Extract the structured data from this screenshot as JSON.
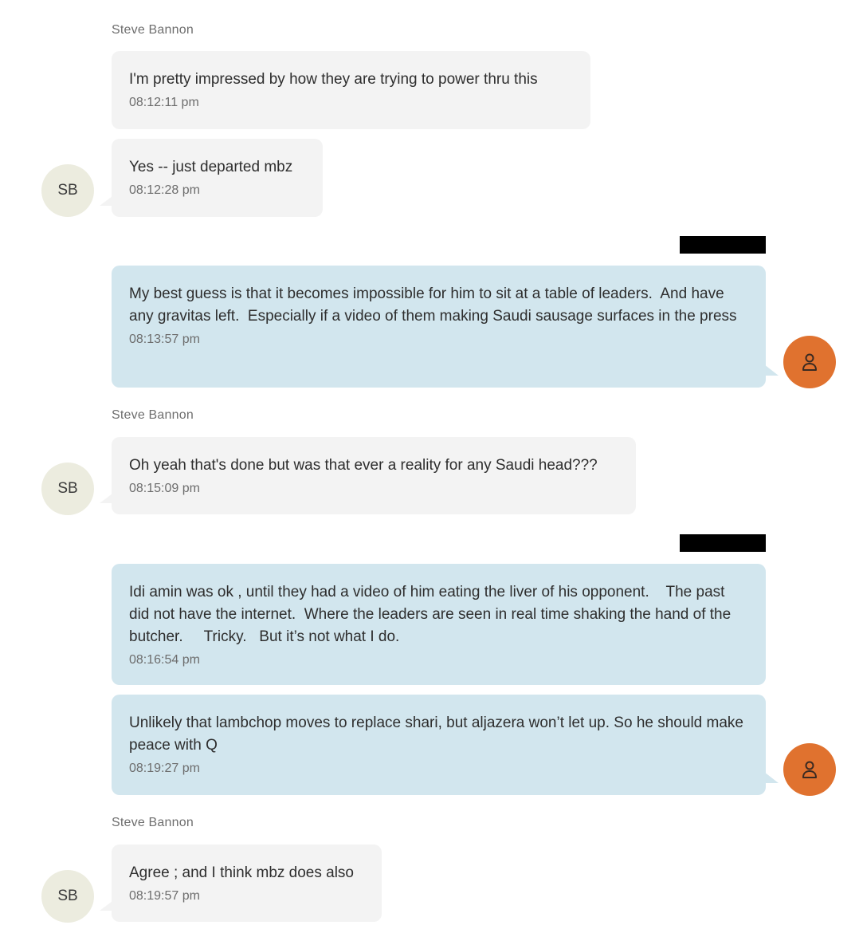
{
  "contact": {
    "name": "Steve Bannon",
    "initials": "SB"
  },
  "colors": {
    "incoming_bubble": "#f3f3f3",
    "outgoing_bubble": "#d2e6ee",
    "contact_avatar": "#ececdf",
    "user_avatar": "#e0722f",
    "redaction": "#000000"
  },
  "messages": [
    {
      "direction": "incoming",
      "text": "I'm pretty impressed by how they are trying to power thru this",
      "time": "08:12:11 pm"
    },
    {
      "direction": "incoming",
      "text": "Yes -- just departed mbz",
      "time": "08:12:28 pm"
    },
    {
      "direction": "outgoing",
      "text": "My best guess is that it becomes impossible for him to sit at a table of leaders.  And have any gravitas left.  Especially if a video of them making Saudi sausage surfaces in the press",
      "time": "08:13:57 pm"
    },
    {
      "direction": "incoming",
      "text": "Oh yeah that's done but was that ever a reality for any Saudi head???",
      "time": "08:15:09 pm"
    },
    {
      "direction": "outgoing",
      "text": "Idi amin was ok , until they had a video of him eating the liver of his opponent.    The past did not have the internet.  Where the leaders are seen in real time shaking the hand of the butcher.     Tricky.   But it’s not what I do.",
      "time": "08:16:54 pm"
    },
    {
      "direction": "outgoing",
      "text": "Unlikely that lambchop moves to replace shari, but aljazera won’t let up. So he should make peace with Q",
      "time": "08:19:27 pm"
    },
    {
      "direction": "incoming",
      "text": "Agree ; and I think mbz does also",
      "time": "08:19:57 pm"
    }
  ]
}
